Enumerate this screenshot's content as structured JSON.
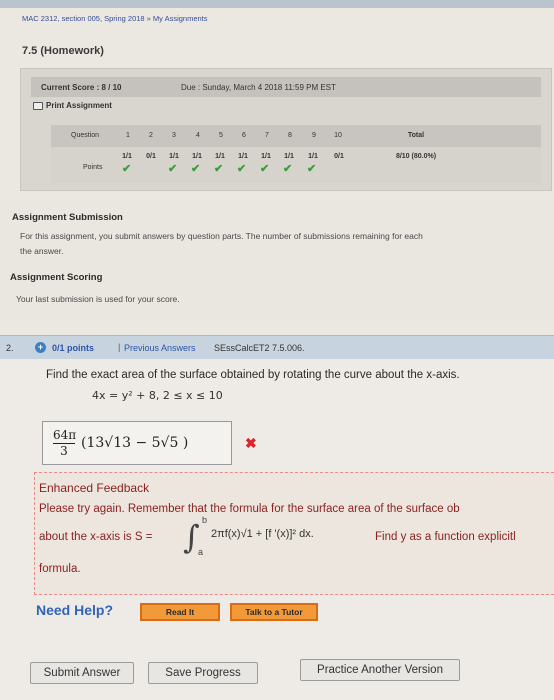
{
  "breadcrumb": "MAC 2312, section 005, Spring 2018 » My Assignments",
  "assignment_title": "7.5 (Homework)",
  "score": {
    "label": "Current Score : 8 / 10",
    "due": "Due : Sunday, March 4 2018 11:59 PM EST"
  },
  "print_label": "Print Assignment",
  "table": {
    "question_label": "Question",
    "points_label": "Points",
    "total_label": "Total",
    "questions": [
      "1",
      "2",
      "3",
      "4",
      "5",
      "6",
      "7",
      "8",
      "9",
      "10"
    ],
    "points": [
      "1/1",
      "0/1",
      "1/1",
      "1/1",
      "1/1",
      "1/1",
      "1/1",
      "1/1",
      "1/1",
      "0/1"
    ],
    "correct": [
      true,
      false,
      true,
      true,
      true,
      true,
      true,
      true,
      true,
      false
    ],
    "total": "8/10 (80.0%)"
  },
  "submission": {
    "heading": "Assignment Submission",
    "text_line1": "For this assignment, you submit answers by question parts. The number of submissions remaining for each",
    "text_line2": "the answer.",
    "scoring_heading": "Assignment Scoring",
    "scoring_text": "Your last submission is used for your score."
  },
  "question": {
    "number": "2.",
    "points": "0/1 points",
    "separator": "|",
    "previous_answers": "Previous Answers",
    "code": "SEssCalcET2 7.5.006.",
    "prompt": "Find the exact area of the surface obtained by rotating the curve about the x-axis.",
    "equation": "4x = y² + 8,    2 ≤ x ≤ 10",
    "answer_numerator": "64π",
    "answer_denominator": "3",
    "answer_expression": "(13√13 − 5√5 )"
  },
  "feedback": {
    "title": "Enhanced Feedback",
    "line1": "Please try again. Remember that the formula for the surface area of the surface ob",
    "line2_start": "about the x-axis is  S =",
    "integral_upper": "b",
    "integral_lower": "a",
    "integrand": "2πf(x)√1 + [f '(x)]²  dx.",
    "line2_end": "Find y as a function explicitl",
    "line3": "formula."
  },
  "help": {
    "need_help": "Need Help?",
    "read_it": "Read It",
    "talk_to_tutor": "Talk to a Tutor"
  },
  "buttons": {
    "submit": "Submit Answer",
    "save": "Save Progress",
    "practice": "Practice Another Version"
  },
  "colors": {
    "link": "#2b56a8",
    "correct": "#3a9e3a",
    "wrong": "#e0222a",
    "feedback": "#8a1f1f",
    "help_button": "#f29a3a"
  }
}
